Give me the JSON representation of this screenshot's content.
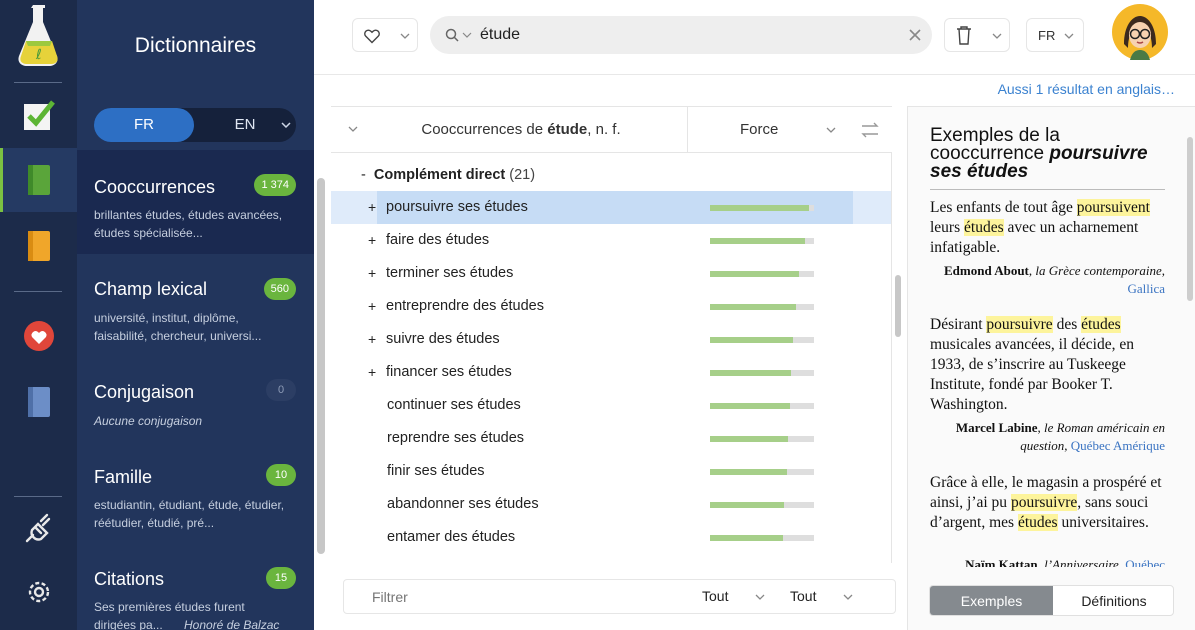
{
  "sidebar": {
    "panel_title": "Dictionnaires",
    "lang_on": "FR",
    "lang_off": "EN",
    "cards": [
      {
        "name": "Cooccurrences",
        "badge": "1 374",
        "desc": "brillantes études, études avancées, études spécialisée..."
      },
      {
        "name": "Champ lexical",
        "badge": "560",
        "desc": "université, institut, diplôme, faisabilité, chercheur, universi..."
      },
      {
        "name": "Conjugaison",
        "badge": "0",
        "desc": "Aucune conjugaison"
      },
      {
        "name": "Famille",
        "badge": "10",
        "desc": "estudiantin, étudiant, étude, étudier, réétudier, étudié, pré..."
      },
      {
        "name": "Citations",
        "badge": "15",
        "desc": "Ses premières études furent dirigées pa...",
        "author": "Honoré de Balzac"
      }
    ]
  },
  "search": {
    "value": "étude",
    "lang": "FR"
  },
  "also": "Aussi 1 résultat en anglais…",
  "table": {
    "title_pre": "Cooccurrences de ",
    "title_word": "étude",
    "title_post": ", n. f.",
    "force": "Force",
    "group_label": "Complément direct",
    "group_count": "(21)",
    "rows": [
      {
        "text": "poursuivre ses études",
        "plus": true,
        "strength": 0.95
      },
      {
        "text": "faire des études",
        "plus": true,
        "strength": 0.91
      },
      {
        "text": "terminer ses études",
        "plus": true,
        "strength": 0.86
      },
      {
        "text": "entreprendre des études",
        "plus": true,
        "strength": 0.83
      },
      {
        "text": "suivre des études",
        "plus": true,
        "strength": 0.8
      },
      {
        "text": "financer ses études",
        "plus": true,
        "strength": 0.78
      },
      {
        "text": "continuer ses études",
        "plus": false,
        "strength": 0.77
      },
      {
        "text": "reprendre ses études",
        "plus": false,
        "strength": 0.75
      },
      {
        "text": "finir ses études",
        "plus": false,
        "strength": 0.74
      },
      {
        "text": "abandonner ses études",
        "plus": false,
        "strength": 0.71
      },
      {
        "text": "entamer des études",
        "plus": false,
        "strength": 0.7
      }
    ]
  },
  "filter": {
    "placeholder": "Filtrer",
    "select1": "Tout",
    "select2": "Tout"
  },
  "examples": {
    "title_pre": "Exemples de la cooccurrence ",
    "title_bold": "poursuivre ses études",
    "e1": {
      "a": "Les enfants de tout âge ",
      "m1": "poursuivent",
      "b": " leurs ",
      "m2": "études",
      "c": " avec un acharnement infatigable.",
      "author": "Edmond About",
      "work": "la Grèce contemporaine",
      "source": "Gallica"
    },
    "e2": {
      "a": "Désirant ",
      "m1": "poursuivre",
      "b": " des ",
      "m2": "études",
      "c": " musicales avancées, il décide, en 1933, de s’inscrire au Tuskeege Institute, fondé par Booker T. Washington.",
      "author": "Marcel Labine",
      "work": "le Roman américain en question",
      "source": "Québec Amérique"
    },
    "e3": {
      "a": "Grâce à elle, le magasin a prospéré et ainsi, j’ai pu ",
      "m1": "poursuivre",
      "b": ", sans souci d’argent, mes ",
      "m2": "études",
      "c": " universitaires.",
      "author": "Naïm Kattan",
      "work": "l’Anniversaire",
      "source": "Québec"
    },
    "tab_on": "Exemples",
    "tab_off": "Définitions"
  }
}
